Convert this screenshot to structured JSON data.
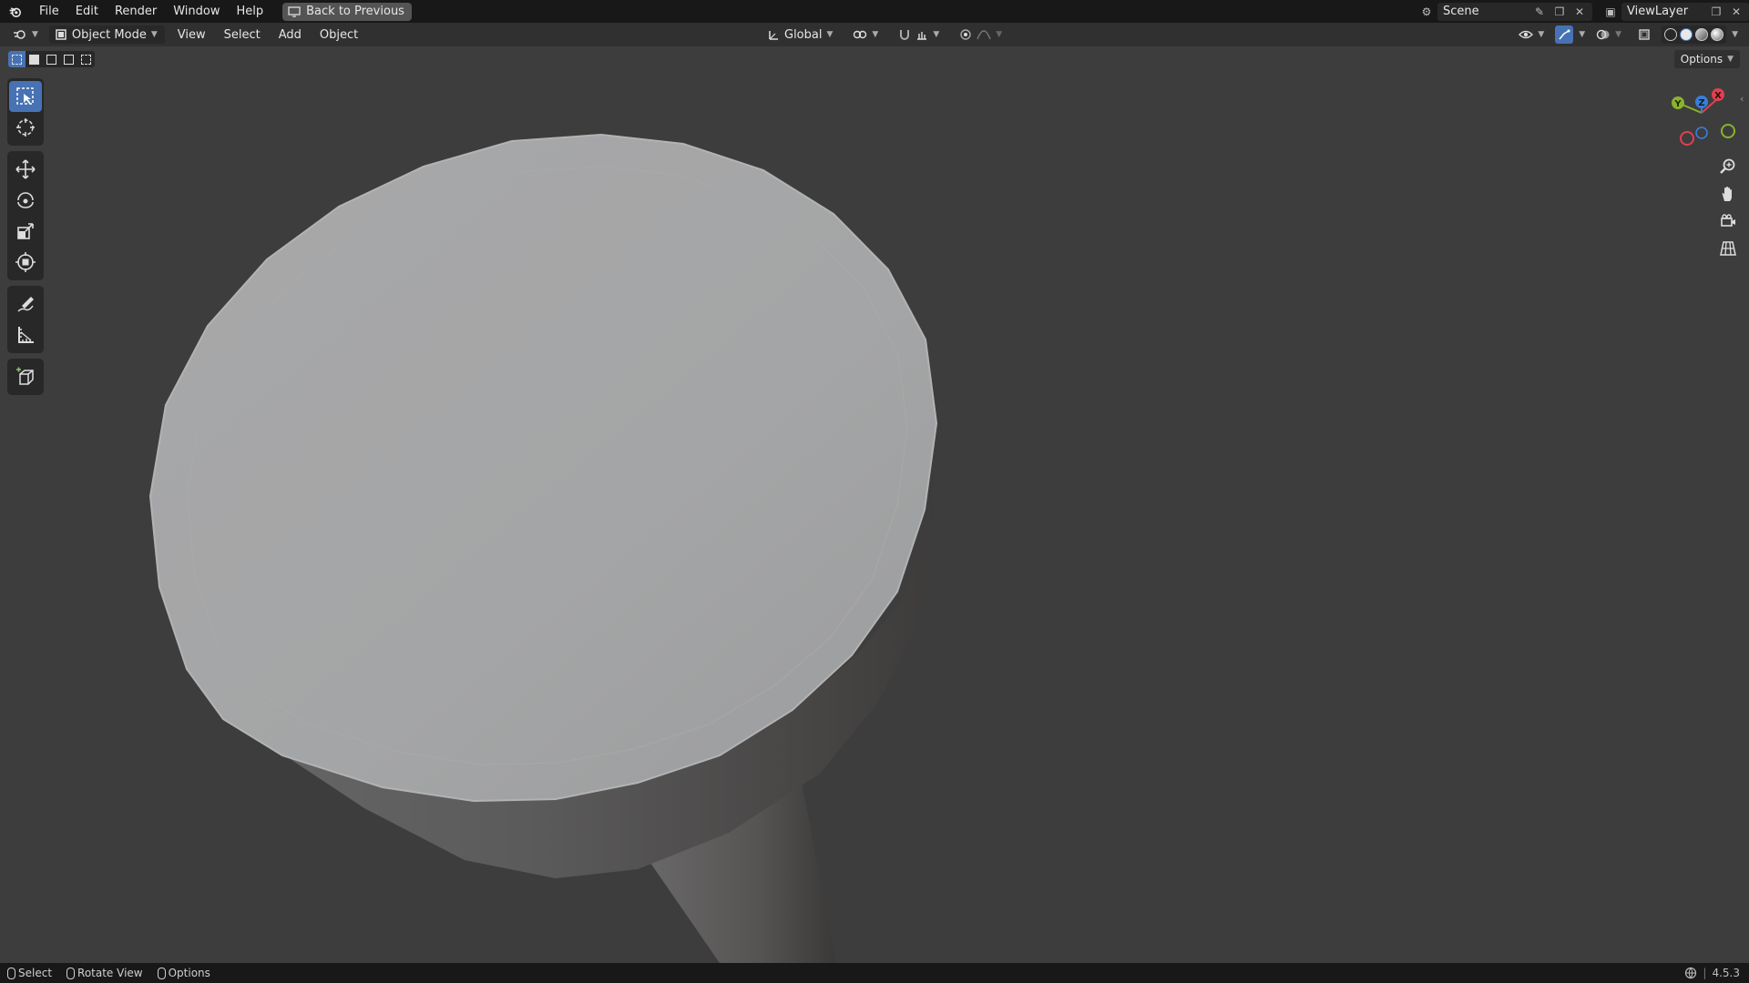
{
  "menubar": {
    "items": [
      "File",
      "Edit",
      "Render",
      "Window",
      "Help"
    ],
    "back_button": "Back to Previous"
  },
  "scene": {
    "label": "Scene"
  },
  "viewlayer": {
    "label": "ViewLayer"
  },
  "header": {
    "mode": "Object Mode",
    "menus": [
      "View",
      "Select",
      "Add",
      "Object"
    ],
    "orientation": "Global"
  },
  "viewport": {
    "options_label": "Options",
    "gizmo_axes": [
      "X",
      "Y",
      "Z"
    ]
  },
  "toolbar": {
    "tools": [
      "select-box",
      "cursor",
      "move",
      "rotate",
      "scale",
      "transform",
      "annotate",
      "measure",
      "add-cube"
    ],
    "active_tool": "select-box"
  },
  "statusbar": {
    "select": "Select",
    "rotate": "Rotate View",
    "options": "Options",
    "version": "4.5.3"
  },
  "colors": {
    "accent": "#4772b3",
    "viewport_bg": "#3d3d3d",
    "axis_x": "#e2404e",
    "axis_y": "#8ab32c",
    "axis_z": "#3a7fd6"
  }
}
